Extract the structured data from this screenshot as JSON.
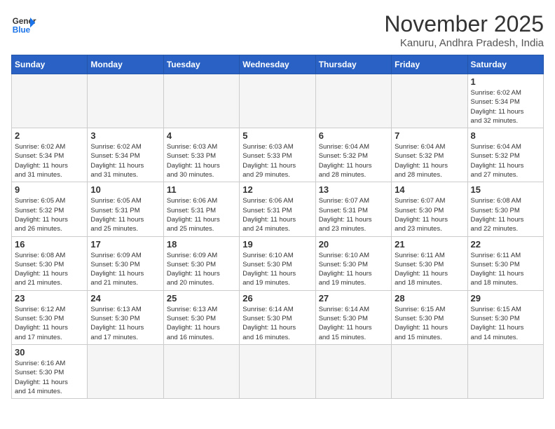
{
  "header": {
    "logo_general": "General",
    "logo_blue": "Blue",
    "month_title": "November 2025",
    "location": "Kanuru, Andhra Pradesh, India"
  },
  "days_of_week": [
    "Sunday",
    "Monday",
    "Tuesday",
    "Wednesday",
    "Thursday",
    "Friday",
    "Saturday"
  ],
  "weeks": [
    [
      {
        "day": null,
        "info": null
      },
      {
        "day": null,
        "info": null
      },
      {
        "day": null,
        "info": null
      },
      {
        "day": null,
        "info": null
      },
      {
        "day": null,
        "info": null
      },
      {
        "day": null,
        "info": null
      },
      {
        "day": "1",
        "info": "Sunrise: 6:02 AM\nSunset: 5:34 PM\nDaylight: 11 hours\nand 32 minutes."
      }
    ],
    [
      {
        "day": "2",
        "info": "Sunrise: 6:02 AM\nSunset: 5:34 PM\nDaylight: 11 hours\nand 31 minutes."
      },
      {
        "day": "3",
        "info": "Sunrise: 6:02 AM\nSunset: 5:34 PM\nDaylight: 11 hours\nand 31 minutes."
      },
      {
        "day": "4",
        "info": "Sunrise: 6:03 AM\nSunset: 5:33 PM\nDaylight: 11 hours\nand 30 minutes."
      },
      {
        "day": "5",
        "info": "Sunrise: 6:03 AM\nSunset: 5:33 PM\nDaylight: 11 hours\nand 29 minutes."
      },
      {
        "day": "6",
        "info": "Sunrise: 6:04 AM\nSunset: 5:32 PM\nDaylight: 11 hours\nand 28 minutes."
      },
      {
        "day": "7",
        "info": "Sunrise: 6:04 AM\nSunset: 5:32 PM\nDaylight: 11 hours\nand 28 minutes."
      },
      {
        "day": "8",
        "info": "Sunrise: 6:04 AM\nSunset: 5:32 PM\nDaylight: 11 hours\nand 27 minutes."
      }
    ],
    [
      {
        "day": "9",
        "info": "Sunrise: 6:05 AM\nSunset: 5:32 PM\nDaylight: 11 hours\nand 26 minutes."
      },
      {
        "day": "10",
        "info": "Sunrise: 6:05 AM\nSunset: 5:31 PM\nDaylight: 11 hours\nand 25 minutes."
      },
      {
        "day": "11",
        "info": "Sunrise: 6:06 AM\nSunset: 5:31 PM\nDaylight: 11 hours\nand 25 minutes."
      },
      {
        "day": "12",
        "info": "Sunrise: 6:06 AM\nSunset: 5:31 PM\nDaylight: 11 hours\nand 24 minutes."
      },
      {
        "day": "13",
        "info": "Sunrise: 6:07 AM\nSunset: 5:31 PM\nDaylight: 11 hours\nand 23 minutes."
      },
      {
        "day": "14",
        "info": "Sunrise: 6:07 AM\nSunset: 5:30 PM\nDaylight: 11 hours\nand 23 minutes."
      },
      {
        "day": "15",
        "info": "Sunrise: 6:08 AM\nSunset: 5:30 PM\nDaylight: 11 hours\nand 22 minutes."
      }
    ],
    [
      {
        "day": "16",
        "info": "Sunrise: 6:08 AM\nSunset: 5:30 PM\nDaylight: 11 hours\nand 21 minutes."
      },
      {
        "day": "17",
        "info": "Sunrise: 6:09 AM\nSunset: 5:30 PM\nDaylight: 11 hours\nand 21 minutes."
      },
      {
        "day": "18",
        "info": "Sunrise: 6:09 AM\nSunset: 5:30 PM\nDaylight: 11 hours\nand 20 minutes."
      },
      {
        "day": "19",
        "info": "Sunrise: 6:10 AM\nSunset: 5:30 PM\nDaylight: 11 hours\nand 19 minutes."
      },
      {
        "day": "20",
        "info": "Sunrise: 6:10 AM\nSunset: 5:30 PM\nDaylight: 11 hours\nand 19 minutes."
      },
      {
        "day": "21",
        "info": "Sunrise: 6:11 AM\nSunset: 5:30 PM\nDaylight: 11 hours\nand 18 minutes."
      },
      {
        "day": "22",
        "info": "Sunrise: 6:11 AM\nSunset: 5:30 PM\nDaylight: 11 hours\nand 18 minutes."
      }
    ],
    [
      {
        "day": "23",
        "info": "Sunrise: 6:12 AM\nSunset: 5:30 PM\nDaylight: 11 hours\nand 17 minutes."
      },
      {
        "day": "24",
        "info": "Sunrise: 6:13 AM\nSunset: 5:30 PM\nDaylight: 11 hours\nand 17 minutes."
      },
      {
        "day": "25",
        "info": "Sunrise: 6:13 AM\nSunset: 5:30 PM\nDaylight: 11 hours\nand 16 minutes."
      },
      {
        "day": "26",
        "info": "Sunrise: 6:14 AM\nSunset: 5:30 PM\nDaylight: 11 hours\nand 16 minutes."
      },
      {
        "day": "27",
        "info": "Sunrise: 6:14 AM\nSunset: 5:30 PM\nDaylight: 11 hours\nand 15 minutes."
      },
      {
        "day": "28",
        "info": "Sunrise: 6:15 AM\nSunset: 5:30 PM\nDaylight: 11 hours\nand 15 minutes."
      },
      {
        "day": "29",
        "info": "Sunrise: 6:15 AM\nSunset: 5:30 PM\nDaylight: 11 hours\nand 14 minutes."
      }
    ],
    [
      {
        "day": "30",
        "info": "Sunrise: 6:16 AM\nSunset: 5:30 PM\nDaylight: 11 hours\nand 14 minutes."
      },
      {
        "day": null,
        "info": null
      },
      {
        "day": null,
        "info": null
      },
      {
        "day": null,
        "info": null
      },
      {
        "day": null,
        "info": null
      },
      {
        "day": null,
        "info": null
      },
      {
        "day": null,
        "info": null
      }
    ]
  ]
}
